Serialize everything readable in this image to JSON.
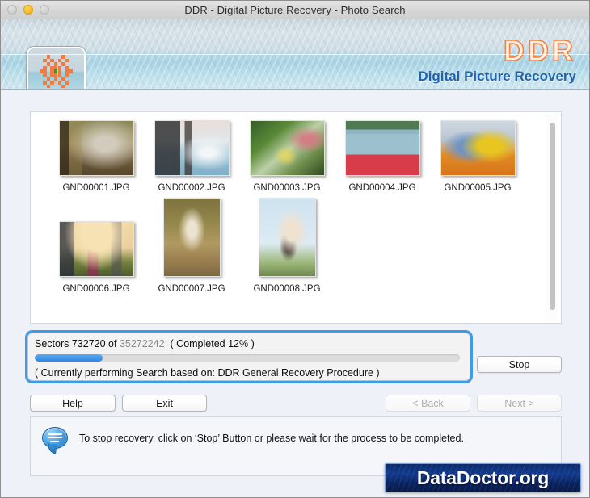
{
  "window": {
    "title": "DDR - Digital Picture Recovery - Photo Search",
    "traffic_lights": [
      "close-disabled",
      "minimize-active",
      "zoom-disabled"
    ]
  },
  "header": {
    "logo_icon": "ddr-flower-logo-icon",
    "brand_title": "DDR",
    "brand_subtitle": "Digital Picture Recovery",
    "brand_title_color": "#f4803c",
    "brand_subtitle_color": "#1f63ad"
  },
  "thumbnails": {
    "scrollbar": "vertical-scrollbar",
    "items": [
      {
        "name": "GND00001.JPG",
        "orientation": "landscape",
        "scene": "girl-sitting-on-swing-in-forest"
      },
      {
        "name": "GND00002.JPG",
        "orientation": "landscape",
        "scene": "couple-by-lake-with-boat"
      },
      {
        "name": "GND00003.JPG",
        "orientation": "landscape",
        "scene": "children-playing-in-green-creek"
      },
      {
        "name": "GND00004.JPG",
        "orientation": "landscape",
        "scene": "person-paddling-red-kayak"
      },
      {
        "name": "GND00005.JPG",
        "orientation": "landscape",
        "scene": "seniors-riding-roller-coaster"
      },
      {
        "name": "GND00006.JPG",
        "orientation": "landscape",
        "scene": "family-cheering-at-sunset"
      },
      {
        "name": "GND00007.JPG",
        "orientation": "portrait",
        "scene": "woman-standing-in-autumn-field"
      },
      {
        "name": "GND00008.JPG",
        "orientation": "portrait",
        "scene": "mother-lifting-child-against-sky"
      }
    ]
  },
  "progress": {
    "sectors_prefix": "Sectors 732720 of",
    "sectors_total": "35272242",
    "completed_label": "( Completed 12% )",
    "percent": 16,
    "status": "( Currently performing Search based on: DDR General Recovery Procedure )",
    "bar_color": "#2f86e0",
    "focus_ring_color": "#3c9ce9"
  },
  "buttons": {
    "stop": "Stop",
    "help": "Help",
    "exit": "Exit",
    "back": "< Back",
    "next": "Next >"
  },
  "note": {
    "icon": "speech-bubble-icon",
    "text": "To stop recovery, click on ‘Stop’ Button or please wait for the process to be completed."
  },
  "watermark": {
    "text": "DataDoctor.org"
  }
}
